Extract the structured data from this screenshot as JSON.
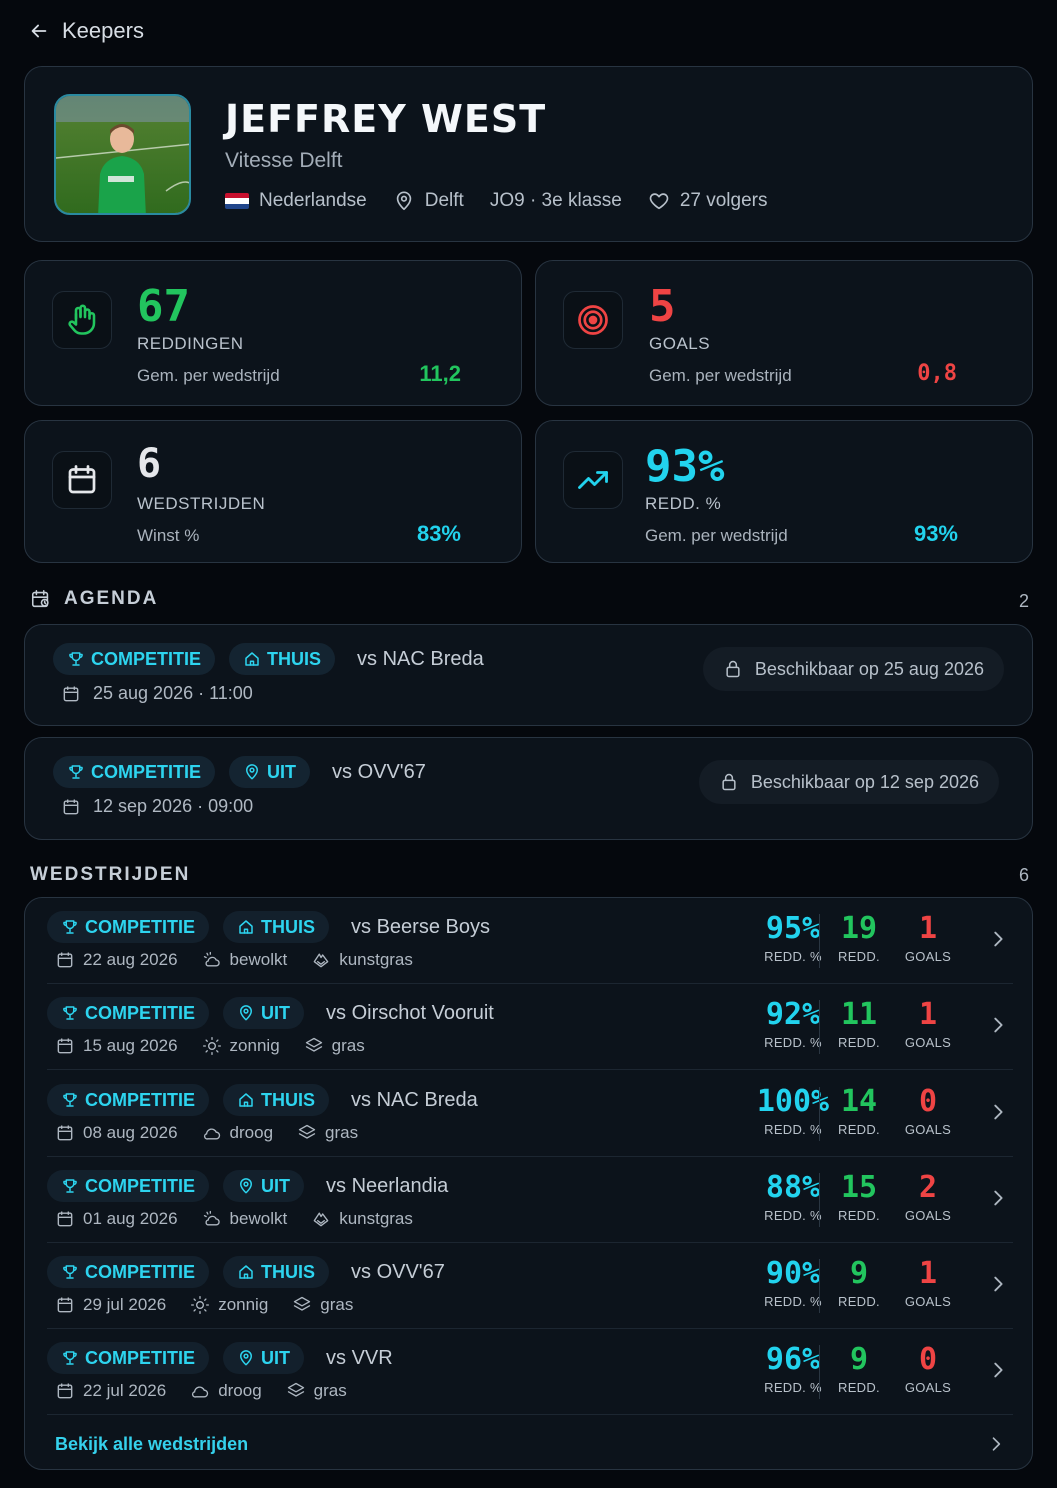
{
  "nav": {
    "back_label": "Keepers"
  },
  "profile": {
    "name": "JEFFREY WEST",
    "club": "Vitesse Delft",
    "nationality": "Nederlandse",
    "city": "Delft",
    "team": "JO9 · 3e klasse",
    "followers": "27 volgers"
  },
  "stats": [
    {
      "value": "67",
      "label": "REDDINGEN",
      "sub": "Gem. per wedstrijd",
      "side": "11,2",
      "color": "#22c55e",
      "icon": "hand-icon"
    },
    {
      "value": "5",
      "label": "GOALS",
      "sub": "Gem. per wedstrijd",
      "side": "0,8",
      "color": "#ef4444",
      "icon": "target-icon"
    },
    {
      "value": "6",
      "label": "WEDSTRIJDEN",
      "sub": "Winst %",
      "side": "83%",
      "color": "#e5e7eb",
      "side_color": "#22d3ee",
      "icon": "calendar-icon"
    },
    {
      "value": "93%",
      "label": "REDD. %",
      "sub": "Gem. per wedstrijd",
      "side": "93%",
      "color": "#22d3ee",
      "icon": "trending-up-icon"
    }
  ],
  "agenda": {
    "title": "AGENDA",
    "count": "2",
    "items": [
      {
        "type": "COMPETITIE",
        "venue": "THUIS",
        "opponent": "vs NAC Breda",
        "datetime": "25 aug 2026 · 11:00",
        "availability": "Beschikbaar op 25 aug 2026"
      },
      {
        "type": "COMPETITIE",
        "venue": "UIT",
        "opponent": "vs OVV'67",
        "datetime": "12 sep 2026 · 09:00",
        "availability": "Beschikbaar op 12 sep 2026"
      }
    ]
  },
  "matches": {
    "title": "WEDSTRIJDEN",
    "count": "6",
    "pct_label": "REDD. %",
    "saves_label": "REDD.",
    "goals_label": "GOALS",
    "items": [
      {
        "type": "COMPETITIE",
        "venue": "THUIS",
        "opponent": "vs Beerse Boys",
        "date": "22 aug 2026",
        "weather": "bewolkt",
        "surface": "kunstgras",
        "pct": "95%",
        "saves": "19",
        "goals": "1"
      },
      {
        "type": "COMPETITIE",
        "venue": "UIT",
        "opponent": "vs Oirschot Vooruit",
        "date": "15 aug 2026",
        "weather": "zonnig",
        "surface": "gras",
        "pct": "92%",
        "saves": "11",
        "goals": "1"
      },
      {
        "type": "COMPETITIE",
        "venue": "THUIS",
        "opponent": "vs NAC Breda",
        "date": "08 aug 2026",
        "weather": "droog",
        "surface": "gras",
        "pct": "100%",
        "saves": "14",
        "goals": "0"
      },
      {
        "type": "COMPETITIE",
        "venue": "UIT",
        "opponent": "vs Neerlandia",
        "date": "01 aug 2026",
        "weather": "bewolkt",
        "surface": "kunstgras",
        "pct": "88%",
        "saves": "15",
        "goals": "2"
      },
      {
        "type": "COMPETITIE",
        "venue": "THUIS",
        "opponent": "vs OVV'67",
        "date": "29 jul 2026",
        "weather": "zonnig",
        "surface": "gras",
        "pct": "90%",
        "saves": "9",
        "goals": "1"
      },
      {
        "type": "COMPETITIE",
        "venue": "UIT",
        "opponent": "vs VVR",
        "date": "22 jul 2026",
        "weather": "droog",
        "surface": "gras",
        "pct": "96%",
        "saves": "9",
        "goals": "0"
      }
    ],
    "footer_link": "Bekijk alle wedstrijden"
  }
}
